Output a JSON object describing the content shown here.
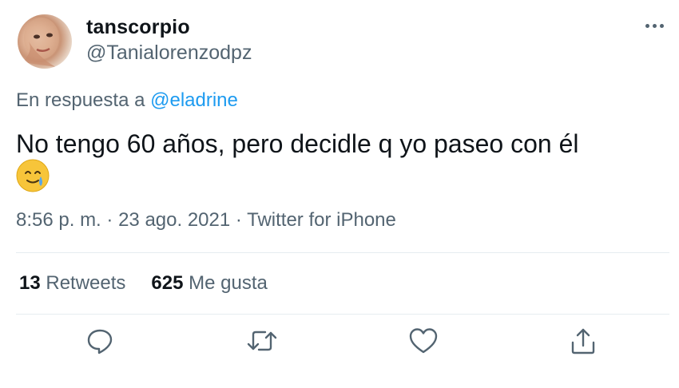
{
  "author": {
    "display_name": "tanscorpio",
    "handle": "@Tanialorenzodpz",
    "avatar_icon": "profile-photo"
  },
  "reply": {
    "prefix": "En respuesta a",
    "mention": "@eladrine"
  },
  "tweet": {
    "text": "No tengo 60 años, pero decidle q yo paseo con él",
    "emoji": "smiling-face-with-tear"
  },
  "meta": {
    "time": "8:56 p. m.",
    "separator": "·",
    "date": "23 ago. 2021",
    "source": "Twitter for iPhone"
  },
  "stats": {
    "retweets_count": "13",
    "retweets_label": "Retweets",
    "likes_count": "625",
    "likes_label": "Me gusta"
  },
  "actions": [
    "reply-icon",
    "retweet-icon",
    "like-icon",
    "share-icon"
  ],
  "colors": {
    "text": "#0f1419",
    "secondary": "#536471",
    "link": "#1d9bf0",
    "divider": "#e6ecf0"
  }
}
